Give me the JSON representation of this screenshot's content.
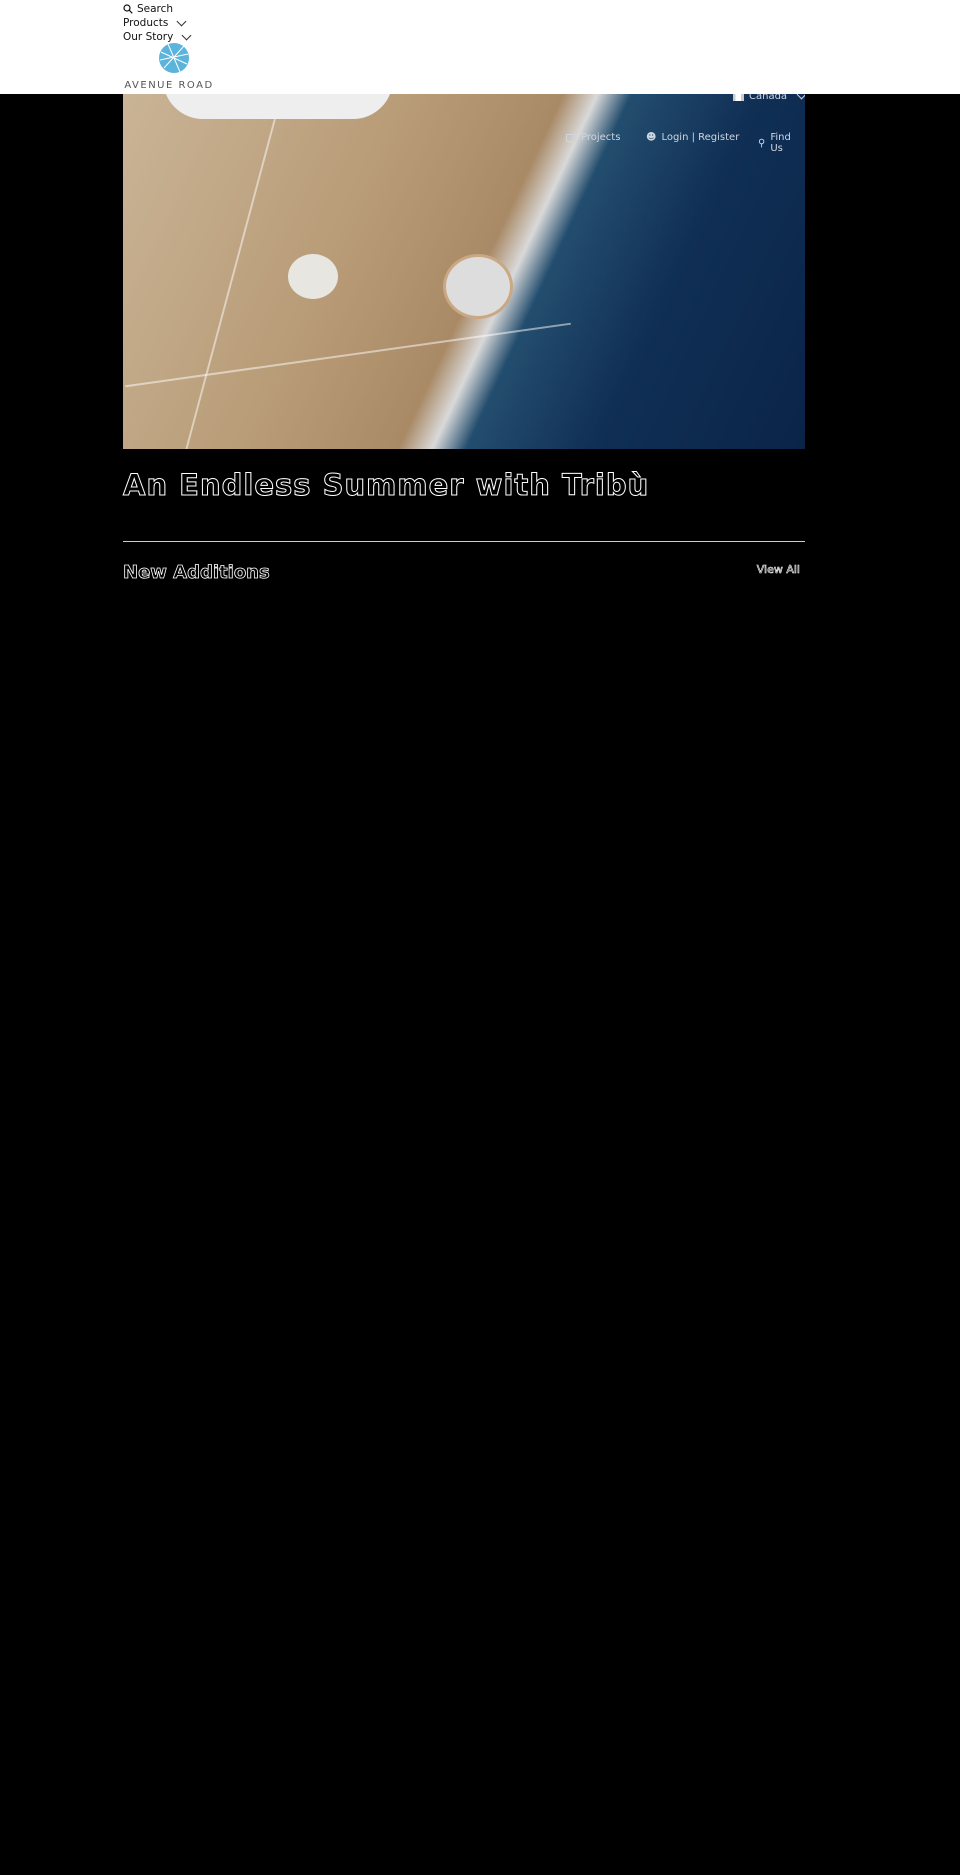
{
  "nav": {
    "search": "Search",
    "products": "Products",
    "our_story": "Our Story"
  },
  "logo": {
    "text": "AVENUE ROAD",
    "color": "#5bb4dc"
  },
  "utility": {
    "country": "Canada",
    "projects": "Projects",
    "login": "Login | Register",
    "find_us": "Find Us"
  },
  "hero": {
    "title": "An Endless Summer with Tribù"
  },
  "section": {
    "title": "New Additions",
    "view_all": "View All"
  }
}
